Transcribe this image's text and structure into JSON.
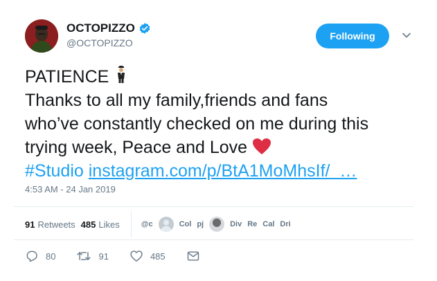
{
  "user": {
    "display_name": "OCTOPIZZO",
    "handle": "@OCTOPIZZO",
    "verified": true,
    "avatar_icon": "user-avatar"
  },
  "follow_button": {
    "label": "Following",
    "color": "#1da1f2"
  },
  "menu_icon": "chevron-down-icon",
  "tweet": {
    "line1": "PATIENCE",
    "line1_emoji": "man-in-business-suit-levitating-icon",
    "line2": "Thanks to all my family,friends and fans",
    "line3": "who’ve constantly checked on me during this",
    "line4": "trying week, Peace and Love",
    "line4_emoji": "red-heart-icon",
    "hashtag": "#Studio",
    "link": "instagram.com/p/BtA1MoMhsIf/  …"
  },
  "timestamp": "4:53 AM - 24 Jan 2019",
  "stats": {
    "retweets_count": "91",
    "retweets_label": "Retweets",
    "likes_count": "485",
    "likes_label": "Likes"
  },
  "likers": [
    "@c",
    "Col",
    "pj",
    "Div",
    "Re",
    "Cal",
    "Dri"
  ],
  "actions": {
    "replies": "80",
    "retweets": "91",
    "likes": "485"
  },
  "colors": {
    "accent": "#1da1f2",
    "muted": "#657786",
    "text": "#14171a",
    "heart": "#e0245e"
  }
}
